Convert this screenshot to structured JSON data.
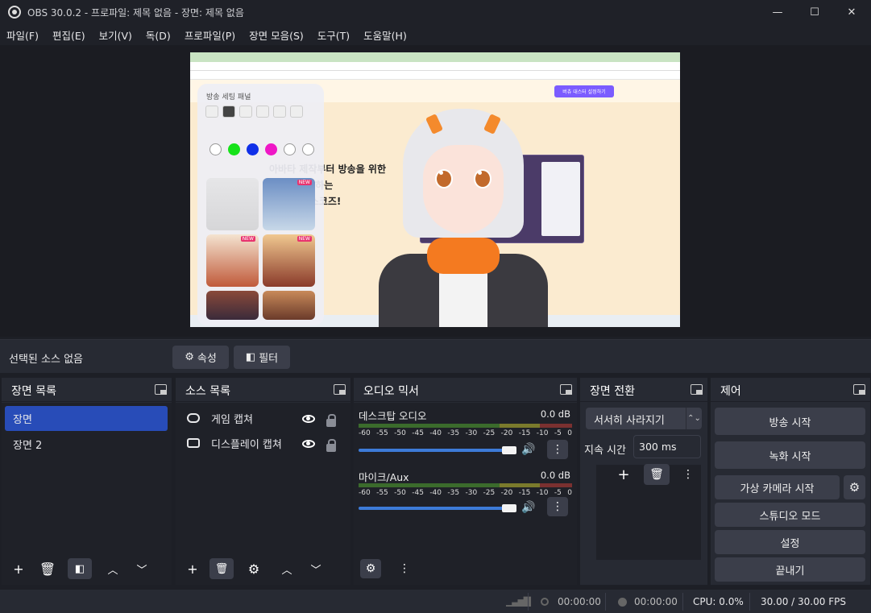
{
  "window": {
    "title": "OBS 30.0.2 - 프로파일: 제목 없음 - 장면: 제목 없음",
    "minimize": "—",
    "maximize": "☐",
    "close": "✕"
  },
  "menu": [
    "파일(F)",
    "편집(E)",
    "보기(V)",
    "독(D)",
    "프로파일(P)",
    "장면 모음(S)",
    "도구(T)",
    "도움말(H)"
  ],
  "preview": {
    "panel_title": "방송 세팅 패널",
    "hero_lines": [
      "아바타 제작부터 방송을 위한",
      "를 제공하는",
      "프, 마스코즈!"
    ],
    "site_button": "버츄 대스터 설정하기",
    "thumb_badge": "NEW"
  },
  "context": {
    "label": "선택된 소스 없음",
    "properties": "속성",
    "filters": "필터"
  },
  "scenes": {
    "title": "장면 목록",
    "items": [
      "장면",
      "장면 2"
    ]
  },
  "sources": {
    "title": "소스 목록",
    "items": [
      "게임 캡쳐",
      "디스플레이 캡쳐"
    ]
  },
  "mixer": {
    "title": "오디오 믹서",
    "scale": [
      "-60",
      "-55",
      "-50",
      "-45",
      "-40",
      "-35",
      "-30",
      "-25",
      "-20",
      "-15",
      "-10",
      "-5",
      "0"
    ],
    "channels": [
      {
        "name": "데스크탑 오디오",
        "db": "0.0 dB",
        "volume": 1.0
      },
      {
        "name": "마이크/Aux",
        "db": "0.0 dB",
        "volume": 1.0
      }
    ]
  },
  "transitions": {
    "title": "장면 전환",
    "selected": "서서히 사라지기",
    "duration_label": "지속 시간",
    "duration_value": "300 ms"
  },
  "controls": {
    "title": "제어",
    "start_stream": "방송 시작",
    "start_record": "녹화 시작",
    "virtual_cam": "가상 카메라 시작",
    "studio_mode": "스튜디오 모드",
    "settings": "설정",
    "exit": "끝내기"
  },
  "status": {
    "stream_time": "00:00:00",
    "record_time": "00:00:00",
    "cpu": "CPU: 0.0%",
    "fps": "30.00 / 30.00 FPS"
  },
  "colors": {
    "accent": "#284cb8",
    "volume": "#3d7bd8",
    "badge": "#e8336e",
    "site_button": "#7b5cff"
  }
}
